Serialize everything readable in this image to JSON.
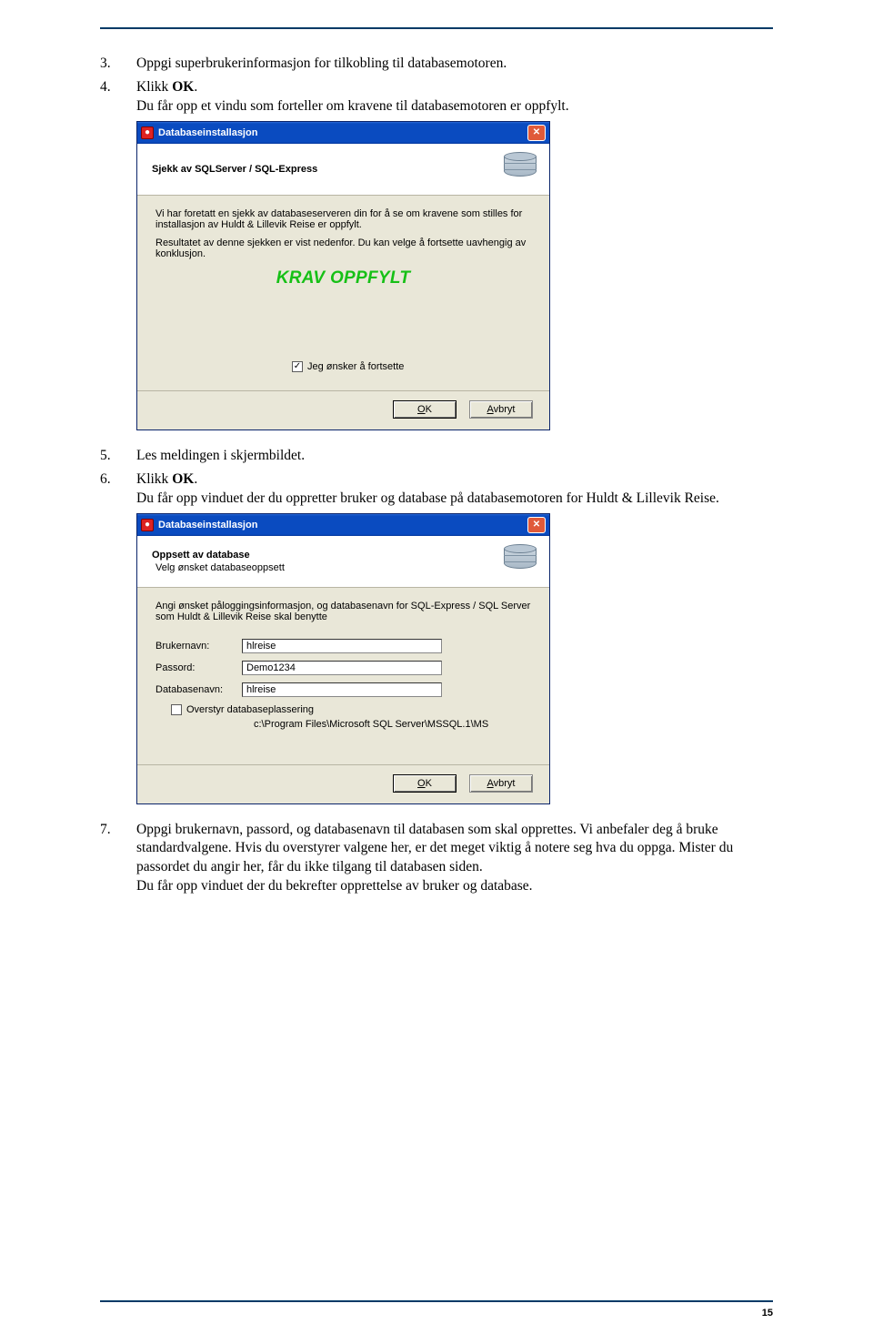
{
  "steps": {
    "s3": {
      "num": "3.",
      "text": "Oppgi superbrukerinformasjon for tilkobling til databasemotoren."
    },
    "s4": {
      "num": "4.",
      "prefix": "Klikk ",
      "bold": "OK",
      "suffix": "."
    },
    "s4_after": "Du får opp et vindu som forteller om kravene til databasemotoren er oppfylt.",
    "s5": {
      "num": "5.",
      "text": "Les meldingen i skjermbildet."
    },
    "s6": {
      "num": "6.",
      "prefix": "Klikk ",
      "bold": "OK",
      "suffix": "."
    },
    "s6_after": "Du får opp vinduet der du oppretter bruker og database på databasemotoren for Huldt & Lillevik Reise.",
    "s7": {
      "num": "7.",
      "text": "Oppgi brukernavn, passord, og databasenavn til databasen som skal opprettes. Vi anbefaler deg å bruke standardvalgene. Hvis du overstyrer valgene her, er det meget viktig å notere seg hva du oppga. Mister du passordet du angir her, får du ikke tilgang til databasen siden."
    },
    "s7_after": "Du får opp vinduet der du bekrefter opprettelse av bruker og database."
  },
  "dialog1": {
    "title": "Databaseinstallasjon",
    "band_title": "Sjekk av SQLServer / SQL-Express",
    "p1": "Vi har foretatt en sjekk av databaseserveren din for å se om kravene som stilles for installasjon av Huldt & Lillevik Reise er oppfylt.",
    "p2": "Resultatet av denne sjekken er vist nedenfor. Du kan velge å fortsette uavhengig av konklusjon.",
    "krav": "KRAV OPPFYLT",
    "chk_label": "Jeg ønsker å fortsette",
    "chk_mark": "✓",
    "ok_u": "O",
    "ok_rest": "K",
    "cancel_u": "A",
    "cancel_rest": "vbryt"
  },
  "dialog2": {
    "title": "Databaseinstallasjon",
    "band_title": "Oppsett av database",
    "band_sub": "Velg ønsket databaseoppsett",
    "p1": "Angi ønsket påloggingsinformasjon, og databasenavn for SQL-Express / SQL Server som Huldt & Lillevik Reise skal benytte",
    "fields": {
      "user_lbl": "Brukernavn:",
      "user_val": "hlreise",
      "pass_lbl": "Passord:",
      "pass_val": "Demo1234",
      "db_lbl": "Databasenavn:",
      "db_val": "hlreise",
      "override_lbl": "Overstyr databaseplassering",
      "path_val": "c:\\Program Files\\Microsoft SQL Server\\MSSQL.1\\MS"
    },
    "ok_u": "O",
    "ok_rest": "K",
    "cancel_u": "A",
    "cancel_rest": "vbryt"
  },
  "page_number": "15"
}
